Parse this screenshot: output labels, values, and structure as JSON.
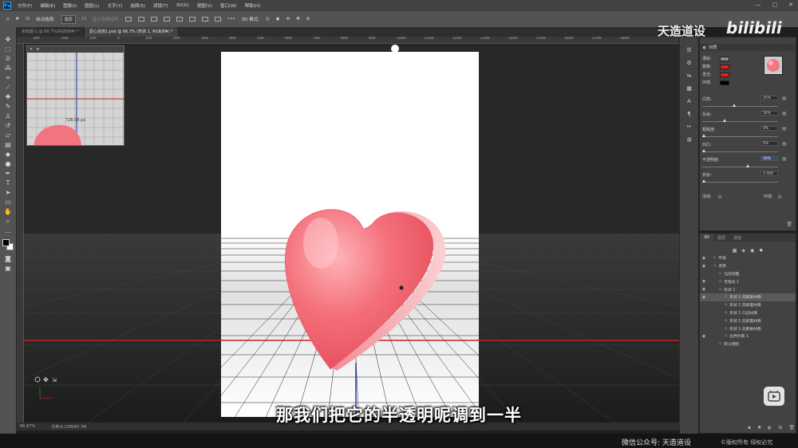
{
  "menubar": {
    "items": [
      "文件(F)",
      "编辑(E)",
      "图像(I)",
      "图层(L)",
      "文字(Y)",
      "选择(S)",
      "滤镜(T)",
      "3D(D)",
      "视图(V)",
      "窗口(W)",
      "帮助(H)"
    ],
    "logo": "Ps"
  },
  "options": {
    "auto_select_label": "自动选择:",
    "auto_select_value": "图层",
    "transform_label": "显示变换控件",
    "mode_label": "3D 模式:"
  },
  "tabs": [
    {
      "label": "未标题-1 @ 66.7%(RGB/8#) *"
    },
    {
      "label": "爱心泡泡1.psd @ 66.7% (形状 1, RGB/8#) *"
    }
  ],
  "ruler_ticks": [
    "300",
    "200",
    "100",
    "0",
    "100",
    "200",
    "300",
    "400",
    "500",
    "600",
    "700",
    "800",
    "900",
    "1000",
    "1100",
    "1200",
    "1300",
    "1400",
    "1500",
    "1600",
    "1700",
    "1800"
  ],
  "navigator": {
    "label": "726.06 px"
  },
  "status": {
    "zoom": "66.67%",
    "doc": "文档:6.22M/65.7M"
  },
  "properties": {
    "title": "材质",
    "materials": [
      {
        "label": "漫射:",
        "color": "#8a8a8a"
      },
      {
        "label": "镜像:",
        "color": "#e0201c"
      },
      {
        "label": "发光:",
        "color": "#e0201c"
      },
      {
        "label": "环境:",
        "color": "#000000"
      }
    ],
    "sliders": [
      {
        "label": "闪亮:",
        "value": "25%",
        "pos": 0.25,
        "highlight": false
      },
      {
        "label": "反射:",
        "value": "26%",
        "pos": 0.26,
        "highlight": false
      },
      {
        "label": "粗糙度:",
        "value": "0%",
        "pos": 0.0,
        "highlight": false
      },
      {
        "label": "凹凸:",
        "value": "0%",
        "pos": 0.0,
        "highlight": false
      },
      {
        "label": "不透明度:",
        "value": "50%",
        "pos": 0.5,
        "highlight": true
      },
      {
        "label": "折射:",
        "value": "1.000",
        "pos": 0.0,
        "highlight": false
      }
    ],
    "normal_label": "法线:",
    "env_label": "环境:"
  },
  "panel3d": {
    "tabs": [
      "3D",
      "图层",
      "通道"
    ],
    "tree": [
      {
        "label": "环境",
        "indent": 1,
        "eye": true,
        "sel": false
      },
      {
        "label": "场景",
        "indent": 1,
        "eye": true,
        "sel": false
      },
      {
        "label": "当前视图",
        "indent": 2,
        "eye": false,
        "sel": false
      },
      {
        "label": "无限光 1",
        "indent": 2,
        "eye": true,
        "sel": false
      },
      {
        "label": "形状 1",
        "indent": 2,
        "eye": true,
        "sel": false
      },
      {
        "label": "形状 1 前膨胀材质",
        "indent": 3,
        "eye": true,
        "sel": true
      },
      {
        "label": "形状 1 前斜面材质",
        "indent": 3,
        "eye": false,
        "sel": false
      },
      {
        "label": "形状 1 凸出材质",
        "indent": 3,
        "eye": false,
        "sel": false
      },
      {
        "label": "形状 1 后斜面材质",
        "indent": 3,
        "eye": false,
        "sel": false
      },
      {
        "label": "形状 1 后膨胀材质",
        "indent": 3,
        "eye": false,
        "sel": false
      },
      {
        "label": "边界约束 1",
        "indent": 3,
        "eye": true,
        "sel": false
      },
      {
        "label": "默认相机",
        "indent": 2,
        "eye": false,
        "sel": false
      }
    ]
  },
  "subtitle": "那我们把它的半透明呢调到一半",
  "watermark": {
    "text": "天造道设",
    "logo": "bilibili"
  },
  "footer": {
    "left": "微信公众号: 天造道设",
    "right": "©版权所有 侵权必究"
  },
  "colors": {
    "heart_main": "#f0606c",
    "heart_light": "#ff9aa4",
    "heart_edge": "#f7b8bd",
    "guide_red": "#c0241e",
    "guide_blue": "#1f36b0"
  }
}
